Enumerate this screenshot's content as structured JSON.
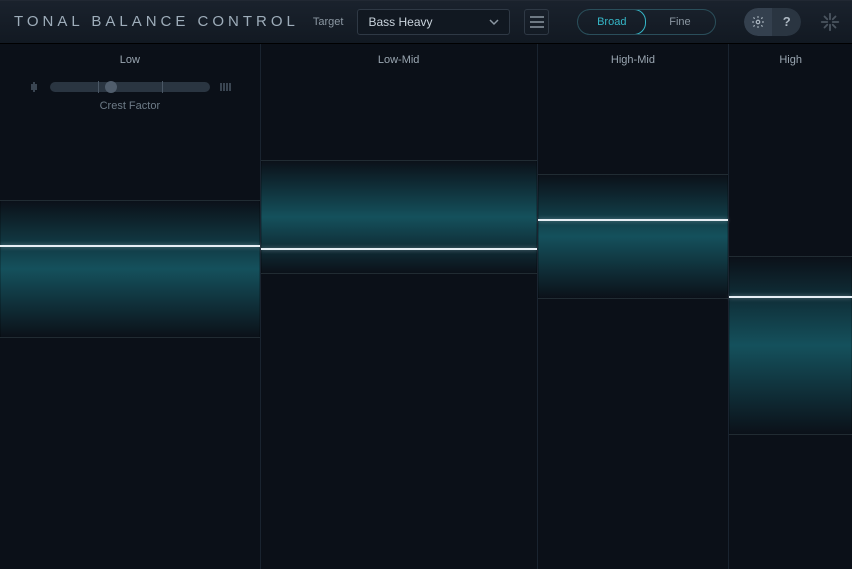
{
  "header": {
    "brand": "TONAL BALANCE CONTROL",
    "target_label": "Target",
    "target_value": "Bass Heavy",
    "view_broad": "Broad",
    "view_fine": "Fine"
  },
  "crest": {
    "label": "Crest Factor",
    "value_pct": 38,
    "ticks_pct": [
      30,
      70
    ]
  },
  "bands": [
    {
      "key": "low",
      "label": "Low",
      "width_pct": 30.6,
      "zone_top_pct": 29.7,
      "zone_height_pct": 26.3,
      "level_pct": 38.3
    },
    {
      "key": "lowmid",
      "label": "Low-Mid",
      "width_pct": 32.5,
      "zone_top_pct": 22.1,
      "zone_height_pct": 21.7,
      "level_pct": 38.9
    },
    {
      "key": "highmid",
      "label": "High-Mid",
      "width_pct": 22.5,
      "zone_top_pct": 24.8,
      "zone_height_pct": 23.8,
      "level_pct": 33.3
    },
    {
      "key": "high",
      "label": "High",
      "width_pct": 14.4,
      "zone_top_pct": 40.4,
      "zone_height_pct": 34.1,
      "level_pct": 48.0
    }
  ],
  "chart_data": {
    "type": "bar",
    "title": "Tonal Balance — Broad view",
    "categories": [
      "Low",
      "Low-Mid",
      "High-Mid",
      "High"
    ],
    "series": [
      {
        "name": "target_zone_top_pct",
        "values": [
          29.7,
          22.1,
          24.8,
          40.4
        ]
      },
      {
        "name": "target_zone_height_pct",
        "values": [
          26.3,
          21.7,
          23.8,
          34.1
        ]
      },
      {
        "name": "level_line_pct",
        "values": [
          38.3,
          38.9,
          33.3,
          48.0
        ]
      }
    ],
    "xlabel": "",
    "ylabel": "",
    "ylim": [
      0,
      100
    ],
    "note": "percentages measured from top of plot area; higher value = lower on screen"
  }
}
